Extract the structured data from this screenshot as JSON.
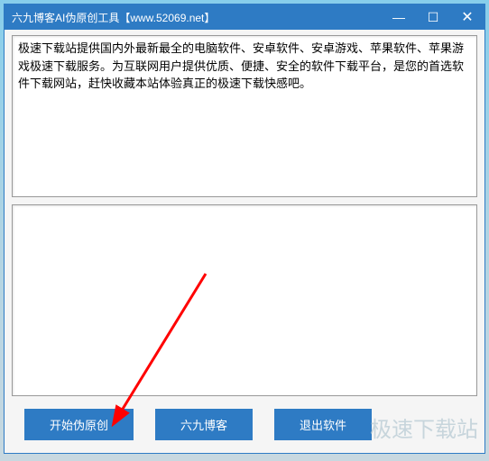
{
  "titlebar": {
    "title": "六九博客AI伪原创工具【www.52069.net】",
    "minimize": "—",
    "maximize": "☐",
    "close": "✕"
  },
  "input": {
    "text": "极速下载站提供国内外最新最全的电脑软件、安卓软件、安卓游戏、苹果软件、苹果游戏极速下载服务。为互联网用户提供优质、便捷、安全的软件下载平台，是您的首选软件下载网站，赶快收藏本站体验真正的极速下载快感吧。"
  },
  "output": {
    "text": ""
  },
  "buttons": {
    "start": "开始伪原创",
    "blog": "六九博客",
    "exit": "退出软件"
  },
  "watermark": "极速下载站"
}
